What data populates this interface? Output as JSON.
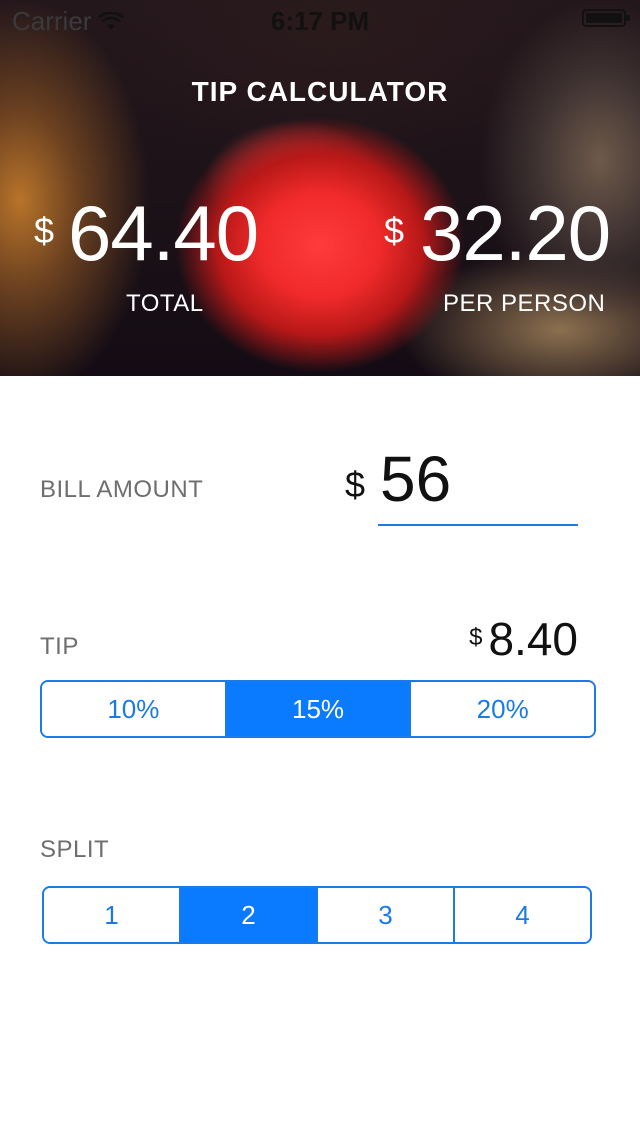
{
  "status_bar": {
    "carrier": "Carrier",
    "time": "6:17 PM"
  },
  "header": {
    "title": "TIP CALCULATOR",
    "currency": "$",
    "total": "64.40",
    "total_label": "TOTAL",
    "per_person": "32.20",
    "per_person_label": "PER PERSON"
  },
  "bill": {
    "label": "BILL AMOUNT",
    "currency": "$",
    "value": "56"
  },
  "tip": {
    "label": "TIP",
    "currency": "$",
    "amount": "8.40",
    "options": [
      "10%",
      "15%",
      "20%"
    ],
    "selected": "15%"
  },
  "split": {
    "label": "SPLIT",
    "options": [
      "1",
      "2",
      "3",
      "4"
    ],
    "selected": "2"
  },
  "colors": {
    "accent": "#0a7aff",
    "label_gray": "#6e6e6e"
  }
}
